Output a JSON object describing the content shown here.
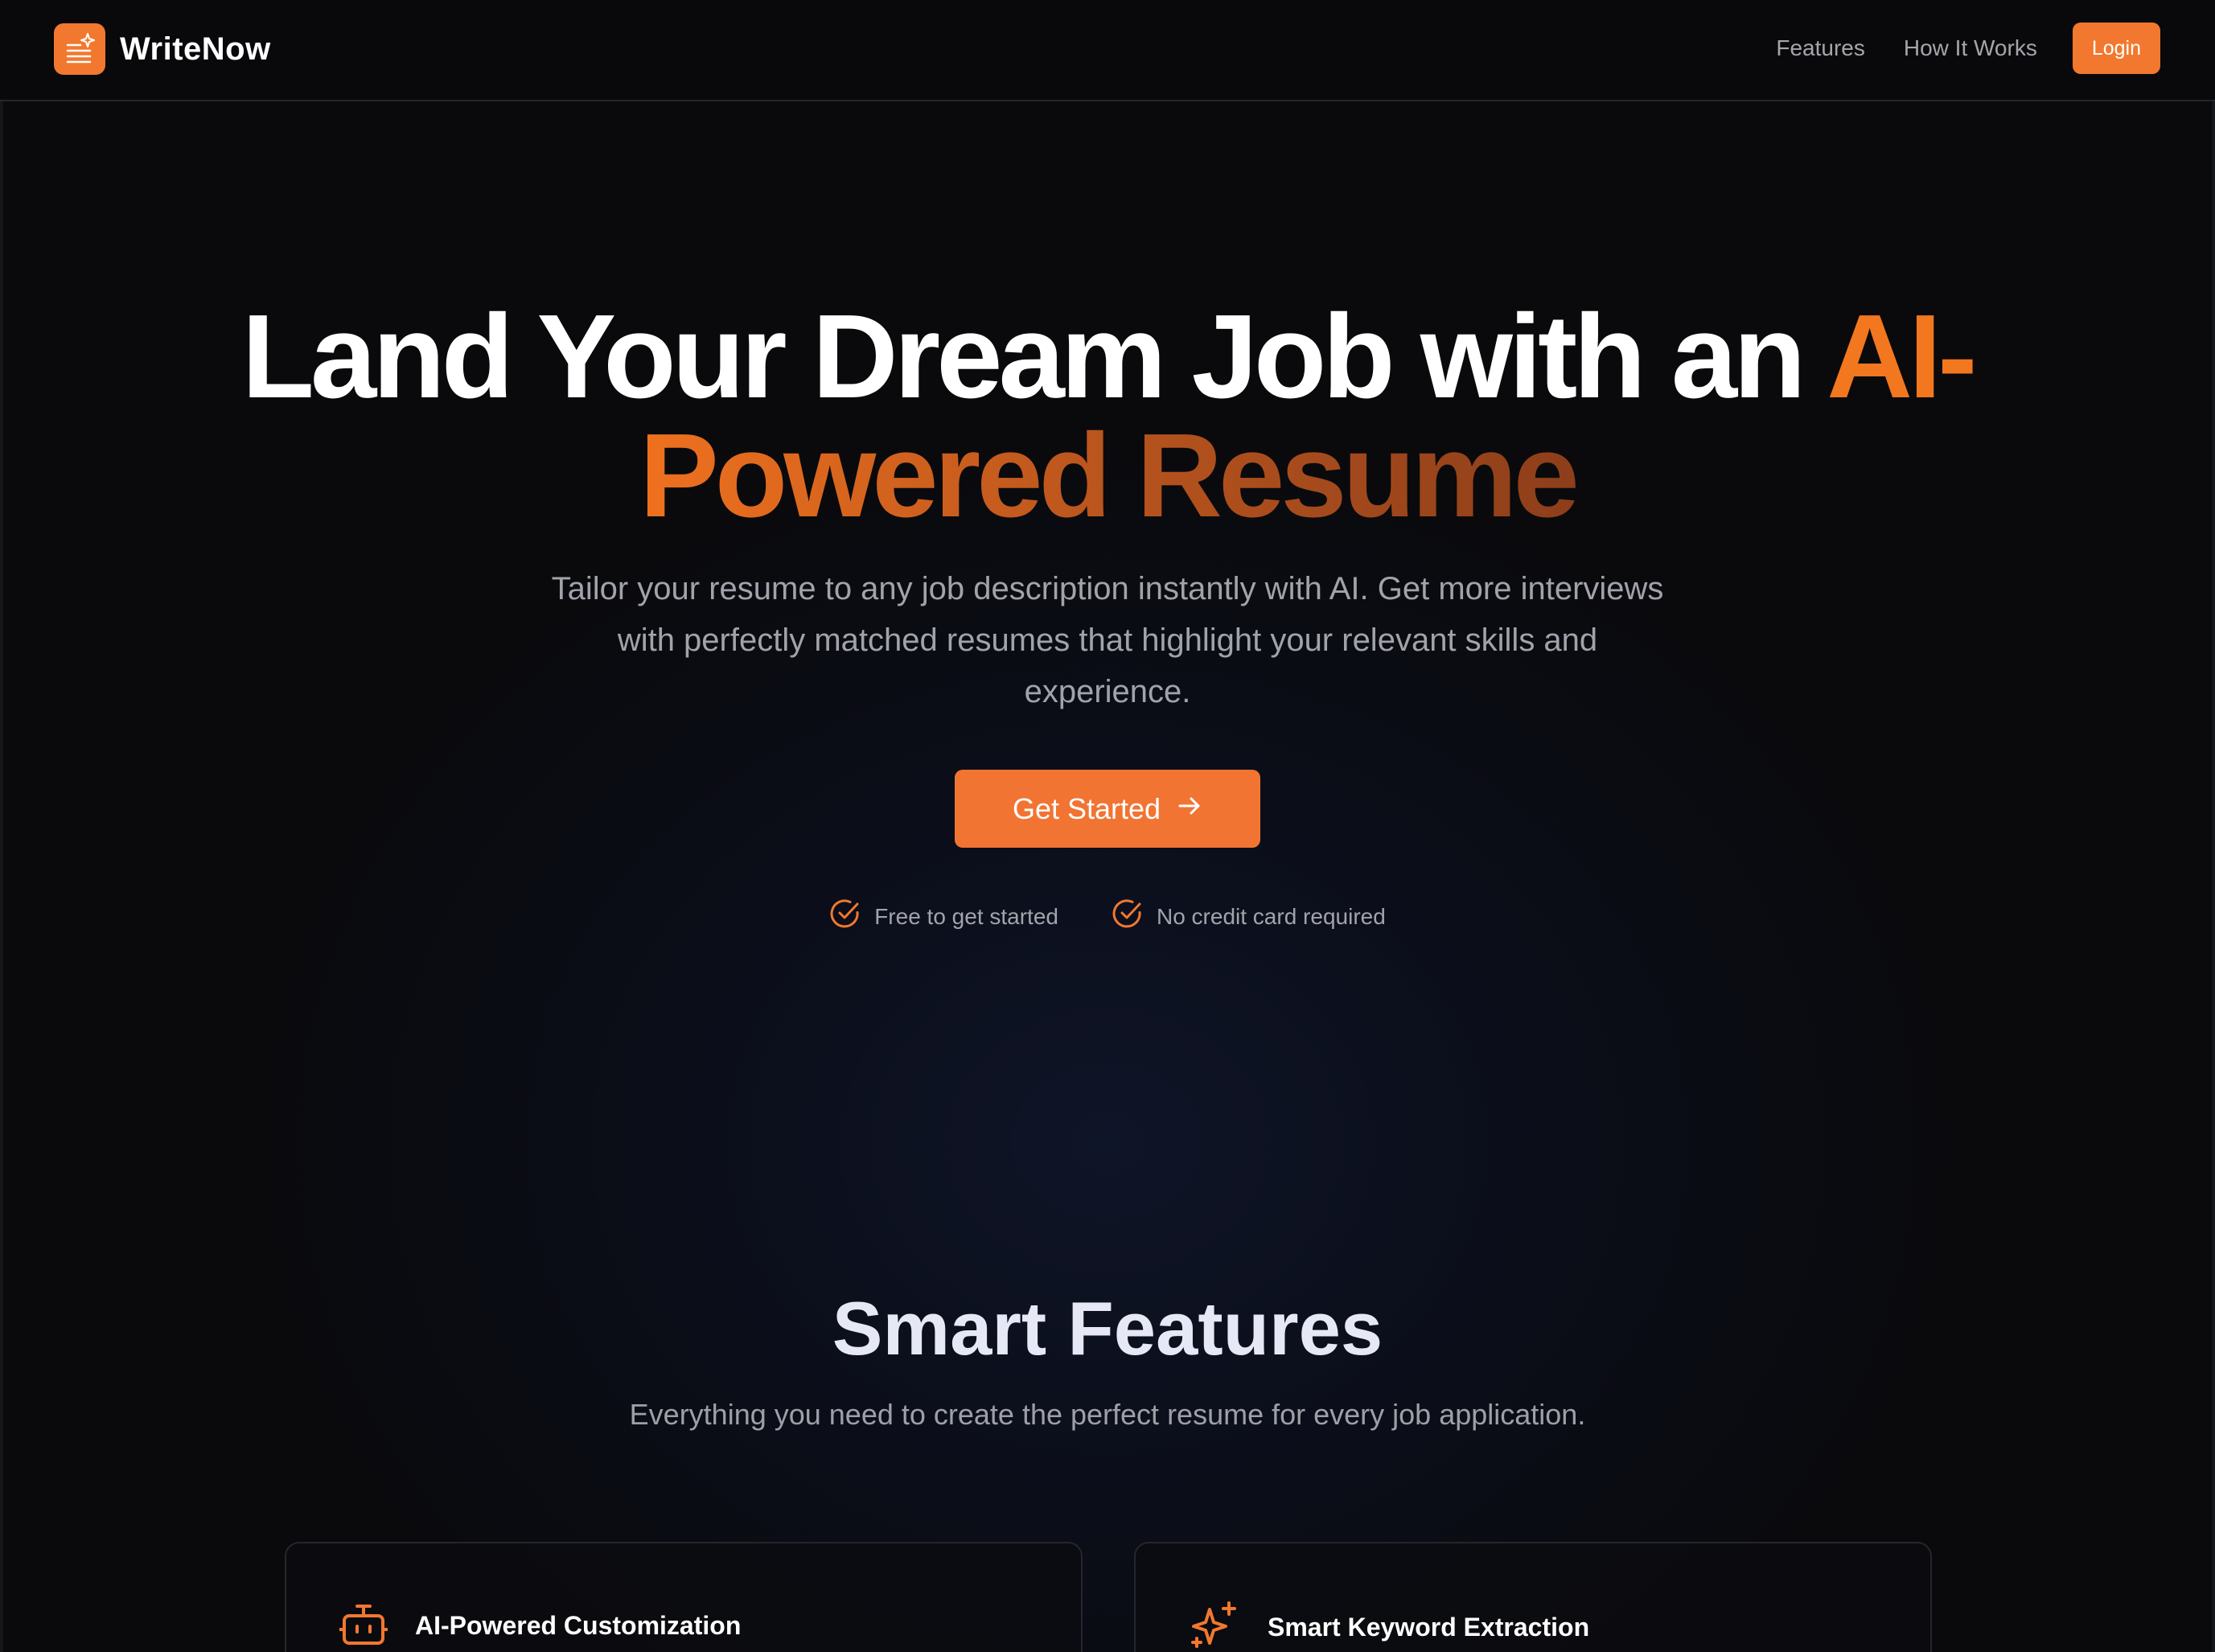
{
  "app": {
    "brand_name": "WriteNow",
    "accent_color": "#f2782f"
  },
  "nav": {
    "items": [
      {
        "label": "Features"
      },
      {
        "label": "How It Works"
      }
    ],
    "login_label": "Login"
  },
  "hero": {
    "title_white": "Land Your Dream Job with an ",
    "title_accent": "AI-",
    "title_gradient": "Powered Resume",
    "subtitle": "Tailor your resume to any job description instantly with AI. Get more interviews with perfectly matched resumes that highlight your relevant skills and experience.",
    "cta_label": "Get Started",
    "cta_icon": "arrow-right-icon",
    "checks": [
      {
        "label": "Free to get started",
        "icon": "check-circle-icon"
      },
      {
        "label": "No credit card required",
        "icon": "check-circle-icon"
      }
    ]
  },
  "features": {
    "title": "Smart Features",
    "subtitle": "Everything you need to create the perfect resume for every job application.",
    "cards": [
      {
        "title": "AI-Powered Customization",
        "icon": "bot-icon"
      },
      {
        "title": "Smart Keyword Extraction",
        "icon": "sparkles-icon"
      }
    ]
  }
}
